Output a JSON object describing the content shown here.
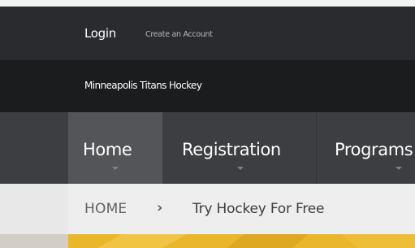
{
  "account_bar": {
    "login_label": "Login",
    "create_account_label": "Create an Account"
  },
  "site_bar": {
    "site_name": "Minneapolis Titans Hockey"
  },
  "main_nav": {
    "items": [
      {
        "label": "Home",
        "active": true
      },
      {
        "label": "Registration",
        "active": false
      },
      {
        "label": "Programs",
        "active": false
      }
    ]
  },
  "breadcrumb": {
    "home_label": "HOME",
    "separator": "›",
    "current_label": "Try Hockey For Free"
  },
  "colors": {
    "account_bar_bg": "#2a2b2e",
    "site_bar_bg": "#1b1c1e",
    "nav_bg": "#3d3e41",
    "nav_active_bg": "#545558",
    "breadcrumb_bg": "#eeeeee",
    "hero_accent": "#e9b62c"
  }
}
